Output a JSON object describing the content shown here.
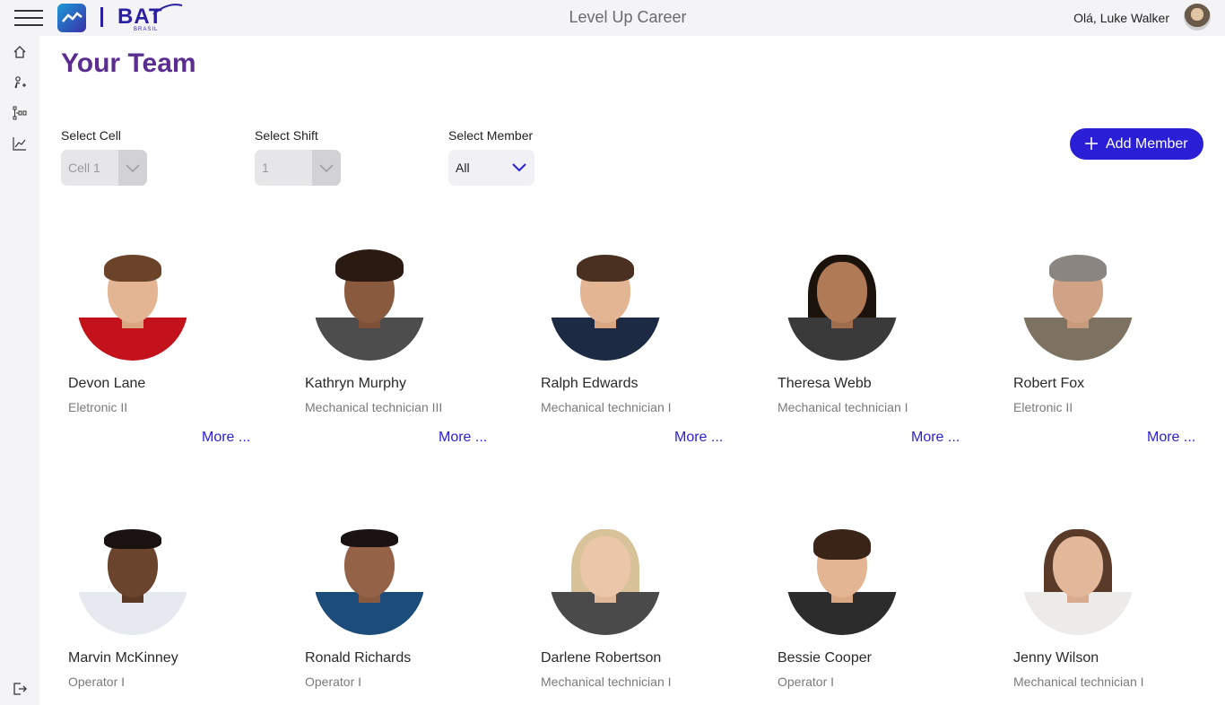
{
  "header": {
    "app_title": "Level Up Career",
    "greeting": "Olá, Luke Walker",
    "brand_main": "BAT",
    "brand_sub": "BRASIL"
  },
  "sidebar": {
    "items": [
      {
        "icon": "home-icon"
      },
      {
        "icon": "person-add-icon"
      },
      {
        "icon": "hierarchy-icon"
      },
      {
        "icon": "chart-icon"
      }
    ],
    "bottom": {
      "icon": "logout-icon"
    }
  },
  "page": {
    "title": "Your Team"
  },
  "filters": {
    "cell": {
      "label": "Select Cell",
      "value": "Cell 1"
    },
    "shift": {
      "label": "Select Shift",
      "value": "1"
    },
    "member": {
      "label": "Select Member",
      "value": "All"
    }
  },
  "add_member_label": "Add Member",
  "more_label": "More ...",
  "members": [
    {
      "name": "Devon Lane",
      "role": "Eletronic II"
    },
    {
      "name": "Kathryn Murphy",
      "role": "Mechanical technician III"
    },
    {
      "name": "Ralph Edwards",
      "role": "Mechanical technician I"
    },
    {
      "name": "Theresa Webb",
      "role": "Mechanical technician I"
    },
    {
      "name": "Robert Fox",
      "role": "Eletronic II"
    },
    {
      "name": "Marvin McKinney",
      "role": "Operator I"
    },
    {
      "name": "Ronald Richards",
      "role": "Operator I"
    },
    {
      "name": "Darlene Robertson",
      "role": "Mechanical technician I"
    },
    {
      "name": "Bessie Cooper",
      "role": "Operator I"
    },
    {
      "name": "Jenny Wilson",
      "role": "Mechanical technician I"
    }
  ],
  "colors": {
    "accent": "#2a1fd6",
    "title": "#5b2d91",
    "brand": "#2a1fa0"
  }
}
